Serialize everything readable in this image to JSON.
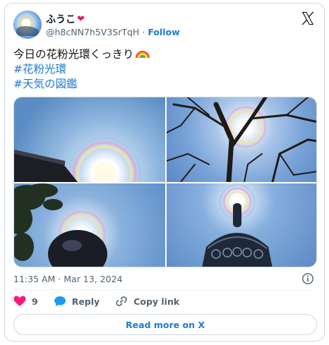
{
  "author": {
    "name": "ふうこ",
    "heart": "❤",
    "handle": "@h8cNN7h5V3SrTqH",
    "separator": "·",
    "follow_label": "Follow"
  },
  "post": {
    "text_line": "今日の花粉光環くっきり",
    "hashtags": [
      "#花粉光環",
      "#天気の図鑑"
    ],
    "timestamp": "11:35 AM · Mar 13, 2024"
  },
  "actions": {
    "likes": "9",
    "reply_label": "Reply",
    "copy_link_label": "Copy link"
  },
  "read_more_label": "Read more on X",
  "colors": {
    "accent": "#1d7bd6",
    "heart": "#f91880",
    "muted": "#536471",
    "border": "#cfd9de"
  },
  "icons": [
    "x-logo-icon",
    "info-icon",
    "heart-icon",
    "reply-icon",
    "link-icon",
    "rainbow-emoji-icon"
  ]
}
